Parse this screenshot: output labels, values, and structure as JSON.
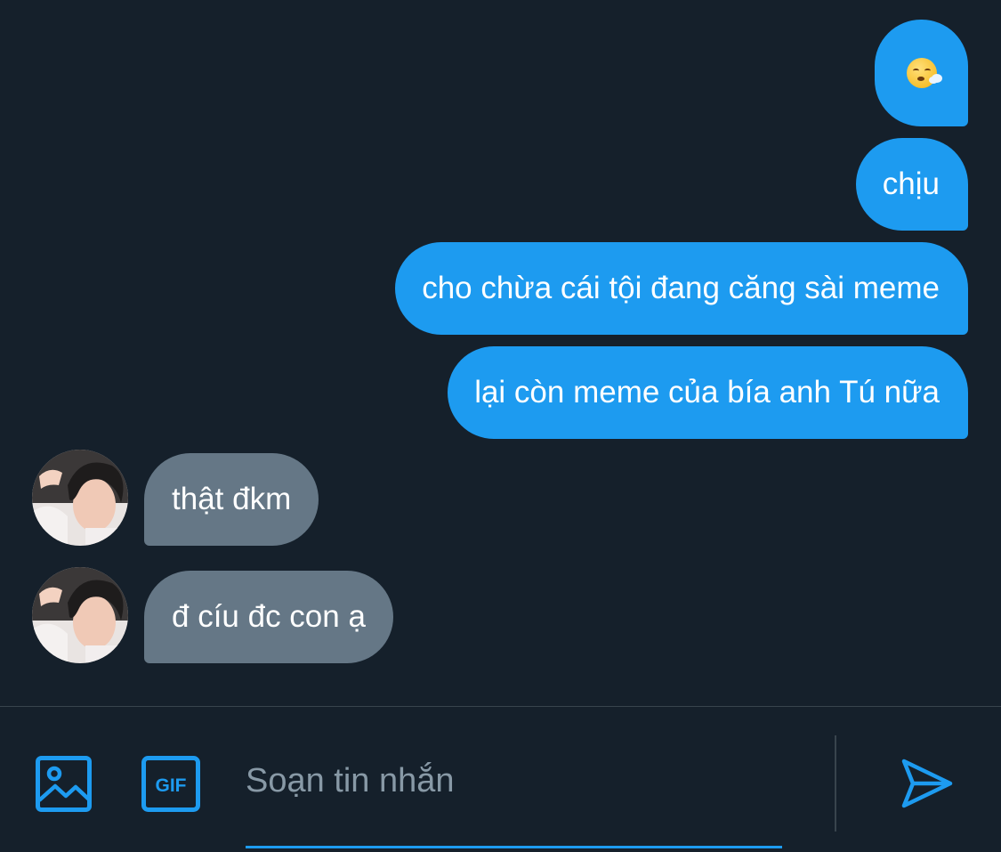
{
  "conversation": {
    "messages": [
      {
        "from": "me",
        "kind": "emoji",
        "icon": "face-exhaling-emoji"
      },
      {
        "from": "me",
        "text": "chịu"
      },
      {
        "from": "me",
        "text": "cho chừa cái tội đang căng sài meme"
      },
      {
        "from": "me",
        "text": "lại còn meme của bía anh Tú nữa"
      },
      {
        "from": "them",
        "text": "thật đkm"
      },
      {
        "from": "them",
        "text": "đ cíu đc con ạ"
      }
    ]
  },
  "composer": {
    "placeholder": "Soạn tin nhắn",
    "value": "",
    "image_button_icon": "image-icon",
    "gif_button_label": "GIF",
    "send_button_icon": "send-icon"
  },
  "colors": {
    "background": "#15202b",
    "sent_bubble": "#1d9bf0",
    "received_bubble": "#657786",
    "accent": "#1d9bf0",
    "divider": "#38444d",
    "placeholder": "#8899a6"
  }
}
